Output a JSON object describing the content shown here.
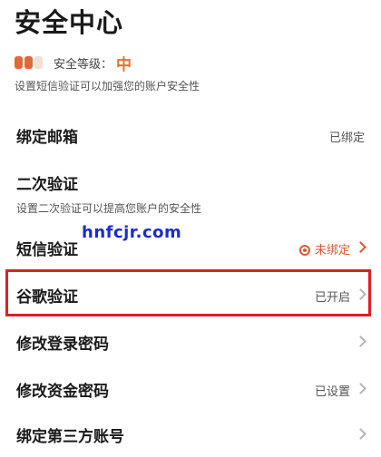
{
  "title": "安全中心",
  "security_level": {
    "label": "安全等级：",
    "value": "中",
    "filled": 2,
    "total": 3
  },
  "level_hint": "设置短信验证可以加强您的账户安全性",
  "rows": {
    "email": {
      "title": "绑定邮箱",
      "status": "已绑定"
    },
    "two_step": {
      "title": "二次验证",
      "hint": "设置二次验证可以提高您账户的安全性"
    },
    "sms": {
      "title": "短信验证",
      "status": "未绑定"
    },
    "google": {
      "title": "谷歌验证",
      "status": "已开启"
    },
    "login_pwd": {
      "title": "修改登录密码"
    },
    "fund_pwd": {
      "title": "修改资金密码",
      "status": "已设置"
    },
    "third_party": {
      "title": "绑定第三方账号"
    }
  },
  "watermark": "hnfcjr.com",
  "colors": {
    "accent": "#e8702a",
    "alert": "#e0573a",
    "highlight": "#e02020",
    "watermark": "#1b2ccf"
  }
}
